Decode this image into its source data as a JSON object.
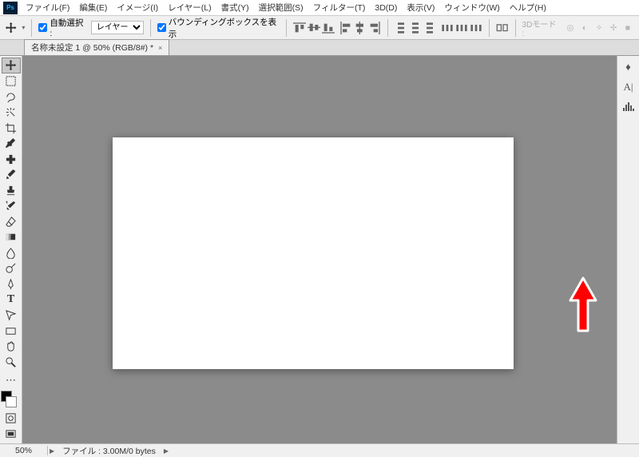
{
  "menu": {
    "items": [
      "ファイル(F)",
      "編集(E)",
      "イメージ(I)",
      "レイヤー(L)",
      "書式(Y)",
      "選択範囲(S)",
      "フィルター(T)",
      "3D(D)",
      "表示(V)",
      "ウィンドウ(W)",
      "ヘルプ(H)"
    ]
  },
  "options": {
    "auto_select_label": "自動選択 :",
    "layer_select": "レイヤー",
    "bbox_label": "バウンディングボックスを表示",
    "mode3d": "3Dモード :"
  },
  "tab": {
    "title": "名称未設定 1 @ 50% (RGB/8#) *",
    "close": "×"
  },
  "status": {
    "zoom": "50%",
    "file": "ファイル : 3.00M/0 bytes"
  }
}
